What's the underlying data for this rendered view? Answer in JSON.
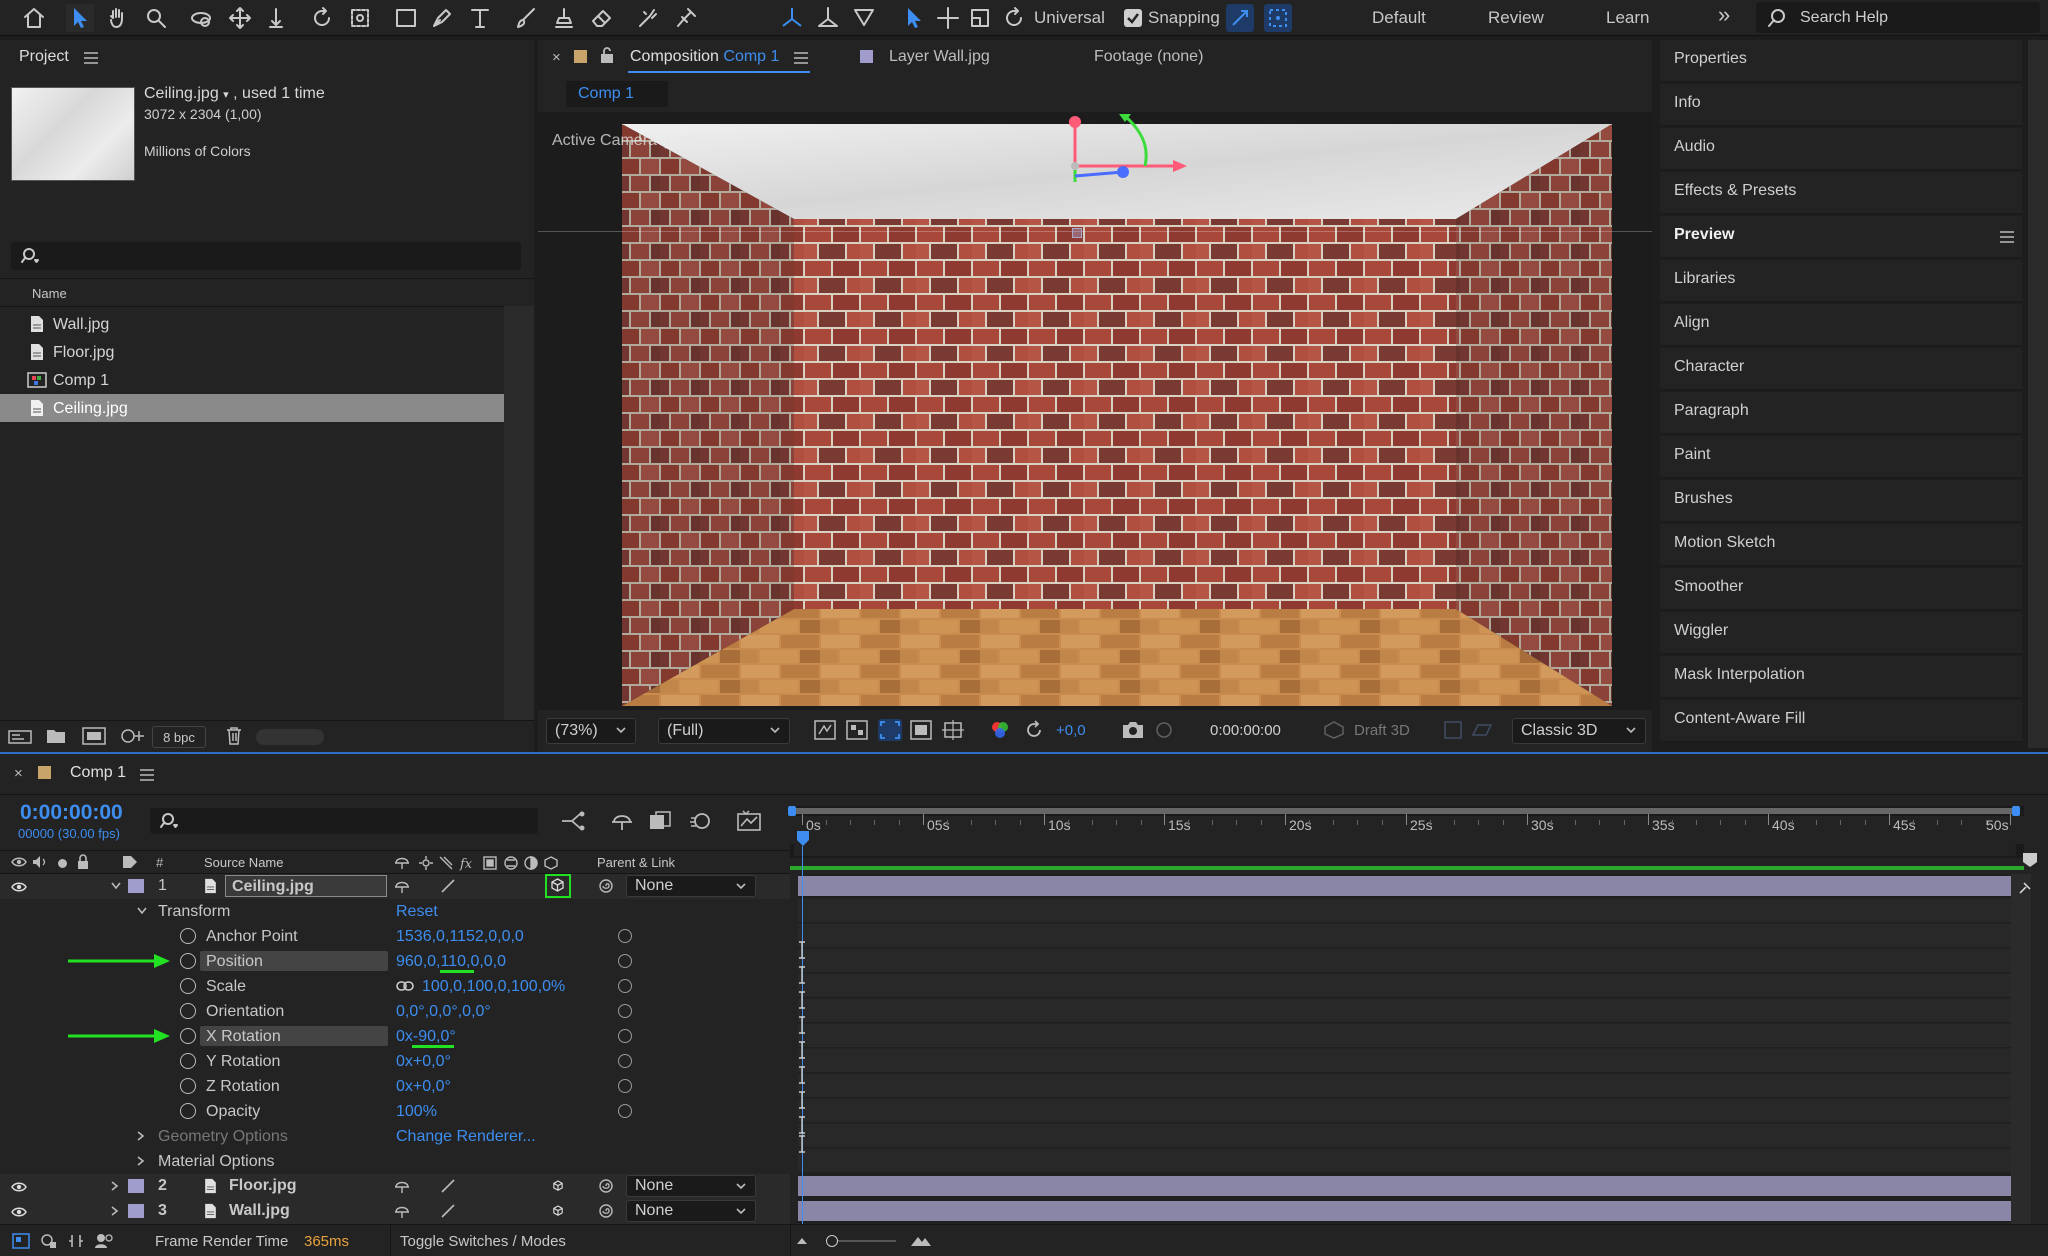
{
  "toolbar": {
    "universal_label": "Universal",
    "snapping_label": "Snapping",
    "workspaces": [
      "Default",
      "Review",
      "Learn"
    ],
    "more": "»",
    "search_placeholder": "Search Help"
  },
  "project": {
    "title": "Project",
    "file_name": "Ceiling.jpg",
    "used": ", used 1 time",
    "dimensions": "3072 x 2304 (1,00)",
    "colors": "Millions of Colors",
    "column_name": "Name",
    "items": [
      {
        "name": "Wall.jpg",
        "type": "file"
      },
      {
        "name": "Floor.jpg",
        "type": "file"
      },
      {
        "name": "Comp 1",
        "type": "comp"
      },
      {
        "name": "Ceiling.jpg",
        "type": "file",
        "selected": true
      }
    ],
    "bpc": "8 bpc"
  },
  "viewer": {
    "tab_composition_prefix": "Composition",
    "tab_composition_name": "Comp 1",
    "tab_layer": "Layer Wall.jpg",
    "tab_footage": "Footage (none)",
    "subtab": "Comp 1",
    "camera_label": "Active Camera (Default)",
    "zoom": "(73%)",
    "resolution": "(Full)",
    "exposure": "+0,0",
    "timecode": "0:00:00:00",
    "draft3d": "Draft 3D",
    "renderer": "Classic 3D"
  },
  "right_panel": {
    "items": [
      "Properties",
      "Info",
      "Audio",
      "Effects & Presets",
      "Preview",
      "Libraries",
      "Align",
      "Character",
      "Paragraph",
      "Paint",
      "Brushes",
      "Motion Sketch",
      "Smoother",
      "Wiggler",
      "Mask Interpolation",
      "Content-Aware Fill"
    ],
    "active": "Preview"
  },
  "timeline": {
    "title": "Comp 1",
    "timecode": "0:00:00:00",
    "frames": "00000 (30.00 fps)",
    "col_num": "#",
    "col_source": "Source Name",
    "col_parent": "Parent & Link",
    "ruler": [
      "0s",
      "05s",
      "10s",
      "15s",
      "20s",
      "25s",
      "30s",
      "35s",
      "40s",
      "45s",
      "50s"
    ],
    "layer1": {
      "num": "1",
      "name": "Ceiling.jpg",
      "parent": "None"
    },
    "transform_label": "Transform",
    "reset_label": "Reset",
    "properties": [
      {
        "name": "Anchor Point",
        "value": "1536,0,1152,0,0,0"
      },
      {
        "name": "Position",
        "value": "960,0,110,0,0,0"
      },
      {
        "name": "Scale",
        "value": "100,0,100,0,100,0%"
      },
      {
        "name": "Orientation",
        "value": "0,0°,0,0°,0,0°"
      },
      {
        "name": "X Rotation",
        "value": "0x-90,0°"
      },
      {
        "name": "Y Rotation",
        "value": "0x+0,0°"
      },
      {
        "name": "Z Rotation",
        "value": "0x+0,0°"
      },
      {
        "name": "Opacity",
        "value": "100%"
      }
    ],
    "geometry_label": "Geometry Options",
    "change_renderer": "Change Renderer...",
    "material_label": "Material Options",
    "layer2": {
      "num": "2",
      "name": "Floor.jpg",
      "parent": "None"
    },
    "layer3": {
      "num": "3",
      "name": "Wall.jpg",
      "parent": "None"
    },
    "frame_render_label": "Frame Render Time",
    "frame_render_value": "365ms",
    "toggle_label": "Toggle Switches / Modes"
  },
  "colors": {
    "accent": "#3d8ef0",
    "annotation": "#22e022",
    "layer_bar": "#8a86a8"
  }
}
